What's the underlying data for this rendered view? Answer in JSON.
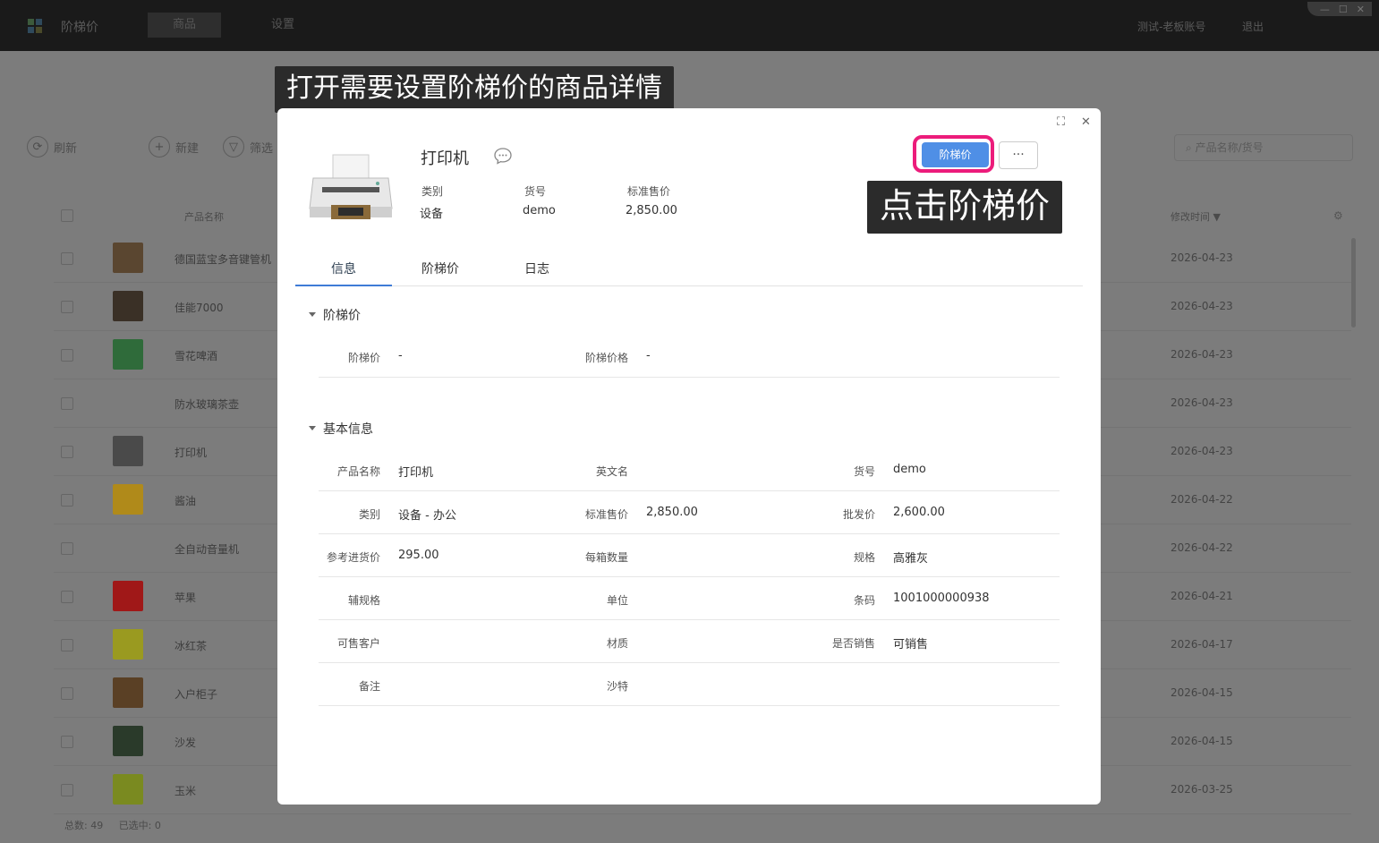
{
  "app": {
    "title": "阶梯价",
    "nav": [
      "商品",
      "设置"
    ],
    "account": "测试-老板账号",
    "logout": "退出"
  },
  "background": {
    "toolbar": {
      "refresh": "刷新",
      "add": "新建",
      "filter": "筛选",
      "search_placeholder": "产品名称/货号"
    },
    "columns": {
      "name": "产品名称",
      "modified": "修改时间"
    },
    "rows": [
      {
        "name": "德国蓝宝多音键管机",
        "date": "2026-04-23"
      },
      {
        "name": "佳能7000",
        "date": "2026-04-23"
      },
      {
        "name": "雪花啤酒",
        "date": "2026-04-23"
      },
      {
        "name": "防水玻璃茶壶",
        "date": "2026-04-23"
      },
      {
        "name": "打印机",
        "date": "2026-04-23"
      },
      {
        "name": "酱油",
        "date": "2026-04-22"
      },
      {
        "name": "全自动音量机",
        "date": "2026-04-22"
      },
      {
        "name": "苹果",
        "date": "2026-04-21"
      },
      {
        "name": "冰红茶",
        "date": "2026-04-17"
      },
      {
        "name": "入户柜子",
        "date": "2026-04-15"
      },
      {
        "name": "沙发",
        "date": "2026-04-15"
      },
      {
        "name": "玉米",
        "date": "2026-03-25"
      }
    ],
    "footer": {
      "total": "总数: 49",
      "selected": "已选中: 0"
    }
  },
  "hints": {
    "open": "打开需要设置阶梯价的商品详情",
    "click": "点击阶梯价"
  },
  "product": {
    "name": "打印机",
    "meta": [
      {
        "label": "类别",
        "value": "设备"
      },
      {
        "label": "货号",
        "value": "demo"
      },
      {
        "label": "标准售价",
        "value": "2,850.00"
      }
    ],
    "tier_button": "阶梯价",
    "more_button": "···"
  },
  "tabs": [
    "信息",
    "阶梯价",
    "日志"
  ],
  "sections": {
    "tier": {
      "title": "阶梯价",
      "fields": [
        {
          "label": "阶梯价",
          "value": "-"
        },
        {
          "label": "阶梯价格",
          "value": "-"
        }
      ]
    },
    "basic": {
      "title": "基本信息",
      "rows": [
        [
          {
            "label": "产品名称",
            "value": "打印机"
          },
          {
            "label": "英文名",
            "value": ""
          },
          {
            "label": "货号",
            "value": "demo"
          }
        ],
        [
          {
            "label": "类别",
            "value": "设备 - 办公"
          },
          {
            "label": "标准售价",
            "value": "2,850.00"
          },
          {
            "label": "批发价",
            "value": "2,600.00"
          }
        ],
        [
          {
            "label": "参考进货价",
            "value": "295.00"
          },
          {
            "label": "每箱数量",
            "value": ""
          },
          {
            "label": "规格",
            "value": "高雅灰"
          }
        ],
        [
          {
            "label": "辅规格",
            "value": ""
          },
          {
            "label": "单位",
            "value": ""
          },
          {
            "label": "条码",
            "value": "1001000000938"
          }
        ],
        [
          {
            "label": "可售客户",
            "value": ""
          },
          {
            "label": "材质",
            "value": ""
          },
          {
            "label": "是否销售",
            "value": "可销售"
          }
        ],
        [
          {
            "label": "备注",
            "value": ""
          },
          {
            "label": "沙特",
            "value": ""
          }
        ]
      ]
    }
  },
  "colors": {
    "accent": "#4f8fe6",
    "highlight": "#ec1c7b",
    "topbar": "#1a1a1a",
    "overlay": "#7c7c7c"
  },
  "icons": [
    "app-logo-icon",
    "refresh-icon",
    "add-icon",
    "filter-icon",
    "search-icon",
    "expand-icon",
    "close-icon",
    "chat-icon",
    "caret-down-icon",
    "settings-icon"
  ]
}
